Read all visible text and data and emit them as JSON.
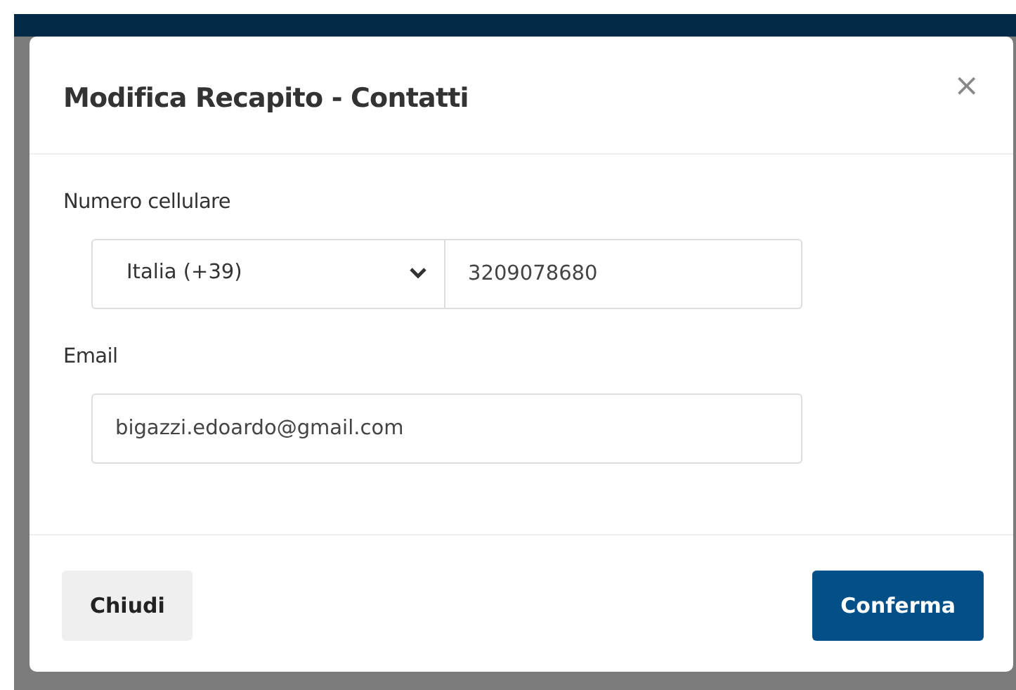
{
  "dialog": {
    "title": "Modifica Recapito - Contatti",
    "close": "×"
  },
  "fields": [
    {
      "kind": "phone",
      "label": "Numero cellulare",
      "country": "Italia (+39)",
      "value": "3209078680"
    },
    {
      "kind": "text",
      "label": "Email",
      "value": "bigazzi.edoardo@gmail.com"
    }
  ],
  "buttons": [
    {
      "label": "Chiudi",
      "kind": "secondary"
    },
    {
      "label": "Conferma",
      "kind": "primary"
    }
  ]
}
